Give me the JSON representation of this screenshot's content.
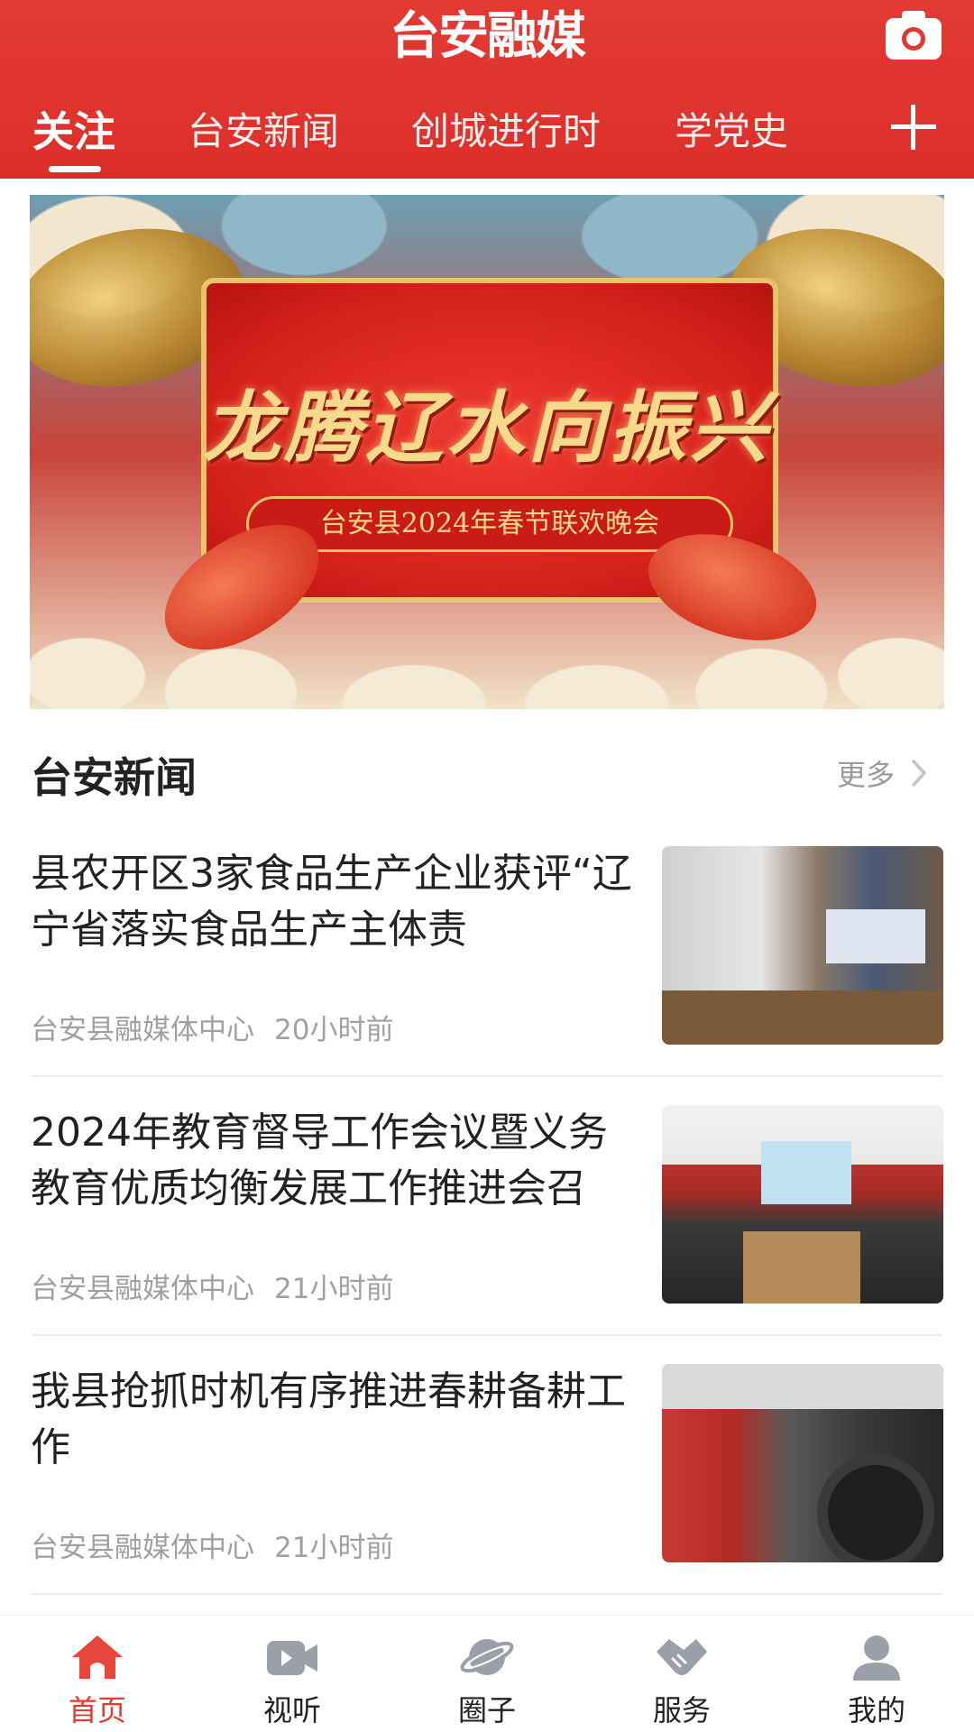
{
  "header": {
    "app_title": "台安融媒",
    "tabs": [
      {
        "label": "关注",
        "active": true
      },
      {
        "label": "台安新闻",
        "active": false
      },
      {
        "label": "创城进行时",
        "active": false
      },
      {
        "label": "学党史",
        "active": false
      }
    ],
    "accent_color": "#e23a33"
  },
  "banner": {
    "headline": "龙腾辽水向振兴",
    "subtitle": "台安县2024年春节联欢晚会"
  },
  "section": {
    "title": "台安新闻",
    "more_label": "更多"
  },
  "news": [
    {
      "title": "县农开区3家食品生产企业获评“辽宁省落实食品生产主体责",
      "source": "台安县融媒体中心",
      "time": "20小时前"
    },
    {
      "title": "2024年教育督导工作会议暨义务教育优质均衡发展工作推进会召",
      "source": "台安县融媒体中心",
      "time": "21小时前"
    },
    {
      "title": "我县抢抓时机有序推进春耕备耕工作",
      "source": "台安县融媒体中心",
      "time": "21小时前"
    }
  ],
  "bottom_nav": [
    {
      "label": "首页",
      "icon": "home-icon",
      "active": true
    },
    {
      "label": "视听",
      "icon": "video-icon",
      "active": false
    },
    {
      "label": "圈子",
      "icon": "planet-icon",
      "active": false
    },
    {
      "label": "服务",
      "icon": "handshake-icon",
      "active": false
    },
    {
      "label": "我的",
      "icon": "user-icon",
      "active": false
    }
  ]
}
